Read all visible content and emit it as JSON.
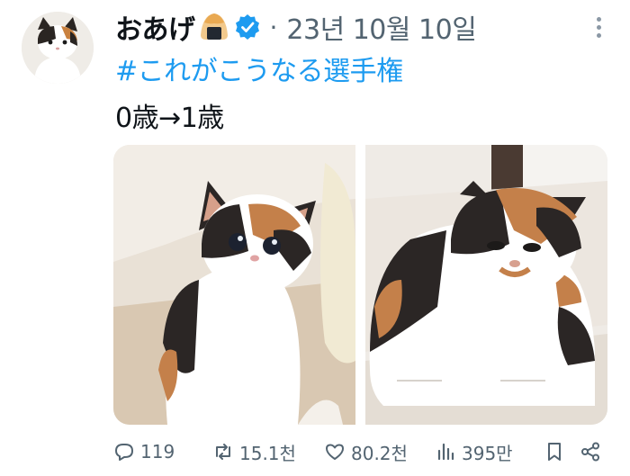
{
  "author": {
    "display_name": "おあげ",
    "emoji_icon": "rice-ball-emoji-icon",
    "verified_icon": "verified-badge-icon",
    "separator": "·",
    "timestamp": "23년 10월 10일"
  },
  "tweet": {
    "hashtag": "#これがこうなる選手権",
    "text": "0歳→1歳"
  },
  "media": {
    "photos": [
      "kitten-photo",
      "adult-cat-photo"
    ]
  },
  "actions": {
    "replies": "119",
    "reposts": "15.1천",
    "likes": "80.2천",
    "views": "395만"
  },
  "colors": {
    "accent": "#1d9bf0",
    "muted": "#536471",
    "text": "#0f1419"
  }
}
